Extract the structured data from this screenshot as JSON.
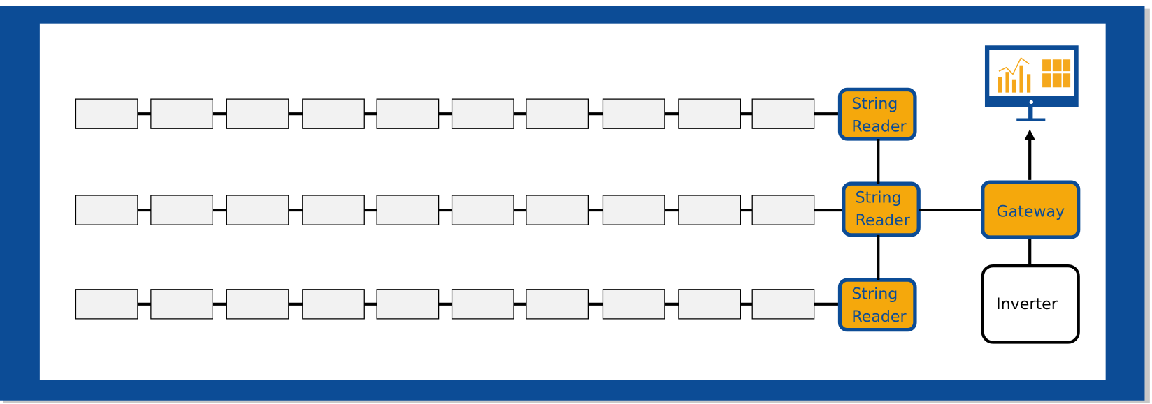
{
  "colors": {
    "frame": "#0c4c96",
    "node_fill": "#f5a80c",
    "node_border": "#0c4c96",
    "node_text": "#0c4c96",
    "panel_fill": "#f2f2f2",
    "line": "#000000"
  },
  "rows": [
    {
      "panels": 10,
      "reader": {
        "line1": "String",
        "line2": "Reader"
      }
    },
    {
      "panels": 10,
      "reader": {
        "line1": "String",
        "line2": "Reader"
      }
    },
    {
      "panels": 10,
      "reader": {
        "line1": "String",
        "line2": "Reader"
      }
    }
  ],
  "gateway": {
    "label": "Gateway"
  },
  "inverter": {
    "label": "Inverter"
  },
  "monitor": {
    "icon": "monitor-dashboard-icon"
  }
}
